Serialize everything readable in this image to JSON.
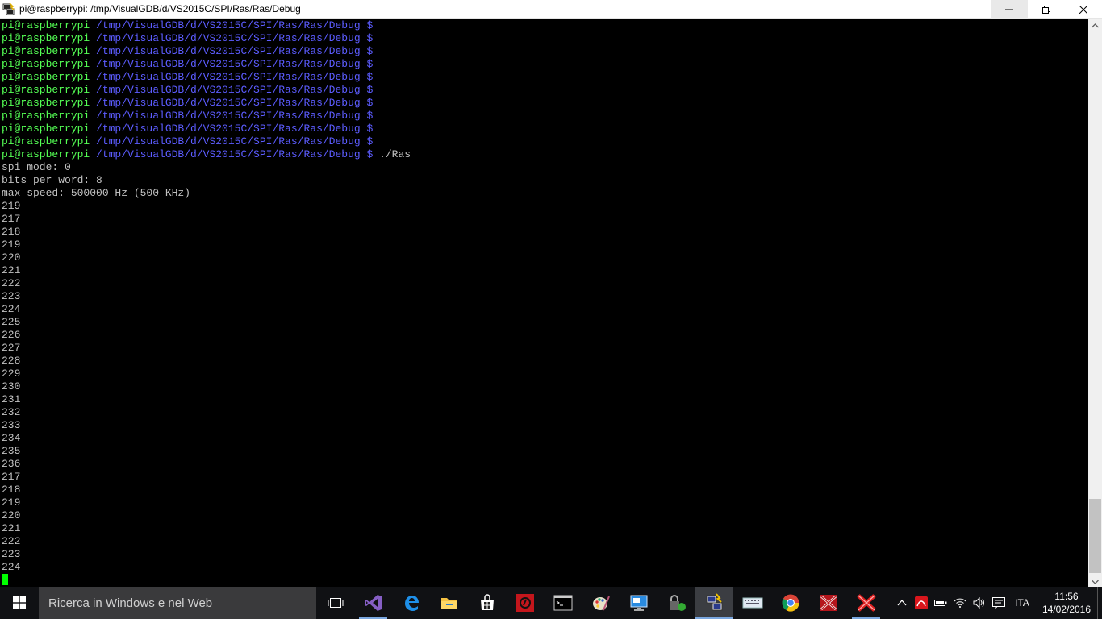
{
  "window": {
    "title": "pi@raspberrypi: /tmp/VisualGDB/d/VS2015C/SPI/Ras/Ras/Debug"
  },
  "terminal": {
    "prompt_user": "pi@raspberrypi",
    "prompt_path": "/tmp/VisualGDB/d/VS2015C/SPI/Ras/Ras/Debug $",
    "empty_prompt_count": 10,
    "command": "./Ras",
    "output": [
      "spi mode: 0",
      "bits per word: 8",
      "max speed: 500000 Hz (500 KHz)",
      "219",
      "217",
      "218",
      "219",
      "220",
      "221",
      "222",
      "223",
      "224",
      "225",
      "226",
      "227",
      "228",
      "229",
      "230",
      "231",
      "232",
      "233",
      "234",
      "235",
      "236",
      "217",
      "218",
      "219",
      "220",
      "221",
      "222",
      "223",
      "224"
    ]
  },
  "taskbar": {
    "search_placeholder": "Ricerca in Windows e nel Web",
    "apps": [
      {
        "name": "task-view-icon",
        "state": "none"
      },
      {
        "name": "visual-studio-icon",
        "state": "open"
      },
      {
        "name": "edge-icon",
        "state": "none"
      },
      {
        "name": "file-explorer-icon",
        "state": "none"
      },
      {
        "name": "store-icon",
        "state": "none"
      },
      {
        "name": "app-red-icon",
        "state": "none"
      },
      {
        "name": "cmd-icon",
        "state": "none"
      },
      {
        "name": "paint-icon",
        "state": "none"
      },
      {
        "name": "remote-desktop-icon",
        "state": "none"
      },
      {
        "name": "lock-app-icon",
        "state": "none"
      },
      {
        "name": "putty-icon",
        "state": "active"
      },
      {
        "name": "keyboard-app-icon",
        "state": "none"
      },
      {
        "name": "chrome-icon",
        "state": "none"
      },
      {
        "name": "red-x-app-icon",
        "state": "none"
      },
      {
        "name": "red-x-app-2-icon",
        "state": "open"
      }
    ],
    "language": "ITA",
    "time": "11:56",
    "date": "14/02/2016"
  },
  "colors": {
    "prompt_user": "#54ff54",
    "prompt_path": "#5c5cff",
    "text": "#c0c0c0",
    "cursor": "#00ff00"
  }
}
